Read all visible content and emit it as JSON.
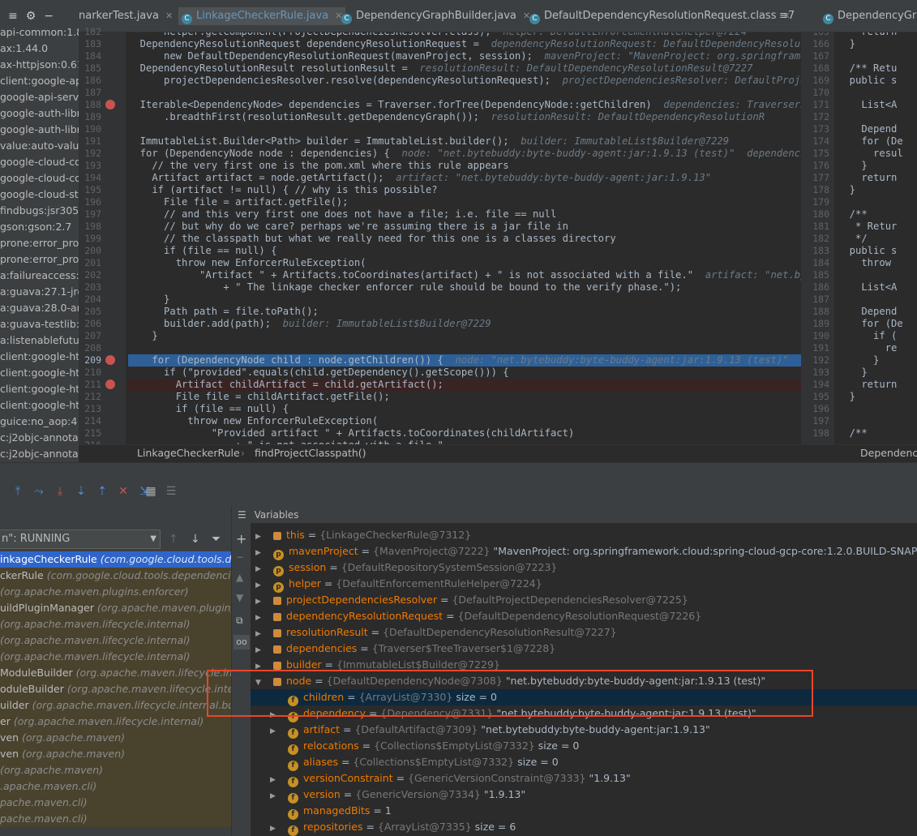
{
  "project_tree": {
    "items": [
      "api-common:1.8.1",
      "ax:1.44.0",
      "ax-httpjson:0.61",
      "client:google-api-c",
      "google-api-servic",
      "google-auth-libra",
      "google-auth-libra",
      "value:auto-value",
      "google-cloud-co",
      "google-cloud-co",
      "google-cloud-st",
      "findbugs:jsr305",
      "gson:gson:2.7",
      "prone:error_pron",
      "prone:error_pron",
      "a:failureaccess:1",
      "a:guava:27.1-jre",
      "a:guava:28.0-an",
      "a:guava-testlib:2",
      "a:listenablefutur",
      "client:google-htt",
      "client:google-htt",
      "client:google-htt",
      "client:google-htt",
      "guice:no_aop:4",
      "c:j2objc-annotat",
      "c:j2objc-annotat"
    ]
  },
  "tabs": [
    {
      "label": "narkerTest.java",
      "active": false,
      "icon": false
    },
    {
      "label": "LinkageCheckerRule.java",
      "active": true,
      "icon": true
    },
    {
      "label": "DependencyGraphBuilder.java",
      "active": false,
      "icon": true
    },
    {
      "label": "DefaultDependencyResolutionRequest.class",
      "active": false,
      "icon": true
    },
    {
      "label": "≡7",
      "active": false,
      "icon": false
    },
    {
      "label": "DependencyGraph",
      "active": false,
      "icon": true
    }
  ],
  "editor": {
    "line_numbers": [
      "182",
      "183",
      "184",
      "185",
      "186",
      "187",
      "188",
      "189",
      "190",
      "191",
      "192",
      "193",
      "194",
      "195",
      "196",
      "197",
      "198",
      "199",
      "200",
      "201",
      "202",
      "203",
      "204",
      "205",
      "206",
      "207",
      "208",
      "209",
      "210",
      "211",
      "212",
      "213",
      "214",
      "215",
      "216"
    ],
    "lines": [
      {
        "code": "      helper.getComponent(ProjectDependenciesResolver.class);",
        "hint": "  helper: DefaultEnforcementRuleHelper@7224"
      },
      {
        "code": "  DependencyResolutionRequest dependencyResolutionRequest =",
        "hint": "  dependencyResolutionRequest: DefaultDependencyResolu"
      },
      {
        "code": "      new DefaultDependencyResolutionRequest(mavenProject, session);",
        "hint": "  mavenProject: \"MavenProject: org.springframe"
      },
      {
        "code": "  DependencyResolutionResult resolutionResult =",
        "hint": "  resolutionResult: DefaultDependencyResolutionResult@7227"
      },
      {
        "code": "      projectDependenciesResolver.resolve(dependencyResolutionRequest);",
        "hint": "  projectDependenciesResolver: DefaultProje"
      },
      {
        "code": "",
        "hint": ""
      },
      {
        "code": "  Iterable<DependencyNode> dependencies = Traverser.forTree(DependencyNode::getChildren)",
        "hint": "  dependencies: Traverser$"
      },
      {
        "code": "      .breadthFirst(resolutionResult.getDependencyGraph());",
        "hint": "  resolutionResult: DefaultDependencyResolutionR"
      },
      {
        "code": "",
        "hint": ""
      },
      {
        "code": "  ImmutableList.Builder<Path> builder = ImmutableList.builder();",
        "hint": "  builder: ImmutableList$Builder@7229"
      },
      {
        "code": "  for (DependencyNode node : dependencies) {",
        "hint": "  node: \"net.bytebuddy:byte-buddy-agent:jar:1.9.13 (test)\"  dependenci"
      },
      {
        "code": "    // the very first one is the pom.xml where this rule appears",
        "hint": ""
      },
      {
        "code": "    Artifact artifact = node.getArtifact();",
        "hint": "  artifact: \"net.bytebuddy:byte-buddy-agent:jar:1.9.13\""
      },
      {
        "code": "    if (artifact != null) { // why is this possible?",
        "hint": ""
      },
      {
        "code": "      File file = artifact.getFile();",
        "hint": ""
      },
      {
        "code": "      // and this very first one does not have a file; i.e. file == null",
        "hint": ""
      },
      {
        "code": "      // but why do we care? perhaps we're assuming there is a jar file in",
        "hint": ""
      },
      {
        "code": "      // the classpath but what we really need for this one is a classes directory",
        "hint": ""
      },
      {
        "code": "      if (file == null) {",
        "hint": ""
      },
      {
        "code": "        throw new EnforcerRuleException(",
        "hint": ""
      },
      {
        "code": "            \"Artifact \" + Artifacts.toCoordinates(artifact) + \" is not associated with a file.\"",
        "hint": "  artifact: \"net.by"
      },
      {
        "code": "                + \" The linkage checker enforcer rule should be bound to the verify phase.\");",
        "hint": ""
      },
      {
        "code": "      }",
        "hint": ""
      },
      {
        "code": "      Path path = file.toPath();",
        "hint": ""
      },
      {
        "code": "      builder.add(path);",
        "hint": "  builder: ImmutableList$Builder@7229"
      },
      {
        "code": "    }",
        "hint": ""
      },
      {
        "code": "",
        "hint": ""
      },
      {
        "code": "    for (DependencyNode child : node.getChildren()) {",
        "hint": "  node: \"net.bytebuddy:byte-buddy-agent:jar:1.9.13 (test)\""
      },
      {
        "code": "      if (\"provided\".equals(child.getDependency().getScope())) {",
        "hint": ""
      },
      {
        "code": "        Artifact childArtifact = child.getArtifact();",
        "hint": ""
      },
      {
        "code": "        File file = childArtifact.getFile();",
        "hint": ""
      },
      {
        "code": "        if (file == null) {",
        "hint": ""
      },
      {
        "code": "          throw new EnforcerRuleException(",
        "hint": ""
      },
      {
        "code": "              \"Provided artifact \" + Artifacts.toCoordinates(childArtifact)",
        "hint": ""
      },
      {
        "code": "                  + \" is not associated with a file.\"",
        "hint": ""
      }
    ],
    "highlight_line_index": 27,
    "error_line_index": 29
  },
  "right_editor": {
    "line_numbers": [
      "165",
      "166",
      "167",
      "168",
      "169",
      "170",
      "171",
      "172",
      "173",
      "174",
      "175",
      "176",
      "177",
      "178",
      "179",
      "180",
      "181",
      "182",
      "183",
      "184",
      "185",
      "186",
      "187",
      "188",
      "189",
      "190",
      "191",
      "192",
      "193",
      "194",
      "195",
      "196",
      "197",
      "198"
    ],
    "lines": [
      "    return",
      "  }",
      "",
      "  /** Retu",
      "  public s",
      "",
      "    List<A",
      "",
      "    Depend",
      "    for (De",
      "      resul",
      "    }",
      "    return",
      "  }",
      "",
      "  /**",
      "   * Retur",
      "   */",
      "  public s",
      "    throw",
      "",
      "    List<A",
      "",
      "    Depend",
      "    for (De",
      "      if (",
      "        re",
      "      }",
      "    }",
      "    return",
      "  }",
      "",
      "",
      "  /**"
    ]
  },
  "breadcrumb": {
    "class": "LinkageCheckerRule",
    "method": "findProjectClasspath()",
    "right": "Dependenc"
  },
  "debug": {
    "thread_label": "n\": RUNNING",
    "variables_title": "Variables",
    "frames": [
      {
        "name": "inkageCheckerRule",
        "pkg": "(com.google.cloud.tools.dep"
      },
      {
        "name": "ckerRule",
        "pkg": "(com.google.cloud.tools.dependencies.e"
      },
      {
        "name": "",
        "pkg": "(org.apache.maven.plugins.enforcer)"
      },
      {
        "name": "uildPluginManager",
        "pkg": "(org.apache.maven.plugin)"
      },
      {
        "name": "",
        "pkg": "(org.apache.maven.lifecycle.internal)"
      },
      {
        "name": "",
        "pkg": "(org.apache.maven.lifecycle.internal)"
      },
      {
        "name": "",
        "pkg": "(org.apache.maven.lifecycle.internal)"
      },
      {
        "name": "ModuleBuilder",
        "pkg": "(org.apache.maven.lifecycle.intern"
      },
      {
        "name": "oduleBuilder",
        "pkg": "(org.apache.maven.lifecycle.interr"
      },
      {
        "name": "uilder",
        "pkg": "(org.apache.maven.lifecycle.internal.build"
      },
      {
        "name": "er",
        "pkg": "(org.apache.maven.lifecycle.internal)"
      },
      {
        "name": "ven",
        "pkg": "(org.apache.maven)"
      },
      {
        "name": "ven",
        "pkg": "(org.apache.maven)"
      },
      {
        "name": "",
        "pkg": "(org.apache.maven)"
      },
      {
        "name": "",
        "pkg": ".apache.maven.cli)"
      },
      {
        "name": "",
        "pkg": "pache.maven.cli)"
      },
      {
        "name": "",
        "pkg": "pache.maven.cli)"
      }
    ],
    "variables": [
      {
        "indent": 0,
        "expand": "▶",
        "icon": "",
        "name": "this",
        "type": "{LinkageCheckerRule@7312}",
        "value": ""
      },
      {
        "indent": 0,
        "expand": "▶",
        "icon": "p",
        "name": "mavenProject",
        "type": "{MavenProject@7222}",
        "value": "\"MavenProject: org.springframework.cloud:spring-cloud-gcp-core:1.2.0.BUILD-SNAPSHOT"
      },
      {
        "indent": 0,
        "expand": "▶",
        "icon": "p",
        "name": "session",
        "type": "{DefaultRepositorySystemSession@7223}",
        "value": ""
      },
      {
        "indent": 0,
        "expand": "▶",
        "icon": "p",
        "name": "helper",
        "type": "{DefaultEnforcementRuleHelper@7224}",
        "value": ""
      },
      {
        "indent": 0,
        "expand": "▶",
        "icon": "",
        "name": "projectDependenciesResolver",
        "type": "{DefaultProjectDependenciesResolver@7225}",
        "value": ""
      },
      {
        "indent": 0,
        "expand": "▶",
        "icon": "",
        "name": "dependencyResolutionRequest",
        "type": "{DefaultDependencyResolutionRequest@7226}",
        "value": ""
      },
      {
        "indent": 0,
        "expand": "▶",
        "icon": "",
        "name": "resolutionResult",
        "type": "{DefaultDependencyResolutionResult@7227}",
        "value": ""
      },
      {
        "indent": 0,
        "expand": "▶",
        "icon": "",
        "name": "dependencies",
        "type": "{Traverser$TreeTraverser$1@7228}",
        "value": ""
      },
      {
        "indent": 0,
        "expand": "▶",
        "icon": "",
        "name": "builder",
        "type": "{ImmutableList$Builder@7229}",
        "value": ""
      },
      {
        "indent": 0,
        "expand": "▼",
        "icon": "",
        "name": "node",
        "type": "{DefaultDependencyNode@7308}",
        "value": "\"net.bytebuddy:byte-buddy-agent:jar:1.9.13 (test)\""
      },
      {
        "indent": 1,
        "expand": "",
        "icon": "f",
        "name": "children",
        "type": "{ArrayList@7330}",
        "value": " size = 0"
      },
      {
        "indent": 1,
        "expand": "▶",
        "icon": "f",
        "name": "dependency",
        "type": "{Dependency@7331}",
        "value": "\"net.bytebuddy:byte-buddy-agent:jar:1.9.13 (test)\""
      },
      {
        "indent": 1,
        "expand": "▶",
        "icon": "f",
        "name": "artifact",
        "type": "{DefaultArtifact@7309}",
        "value": "\"net.bytebuddy:byte-buddy-agent:jar:1.9.13\""
      },
      {
        "indent": 1,
        "expand": "",
        "icon": "f",
        "name": "relocations",
        "type": "{Collections$EmptyList@7332}",
        "value": " size = 0"
      },
      {
        "indent": 1,
        "expand": "",
        "icon": "f",
        "name": "aliases",
        "type": "{Collections$EmptyList@7332}",
        "value": " size = 0"
      },
      {
        "indent": 1,
        "expand": "▶",
        "icon": "f",
        "name": "versionConstraint",
        "type": "{GenericVersionConstraint@7333}",
        "value": "\"1.9.13\""
      },
      {
        "indent": 1,
        "expand": "▶",
        "icon": "f",
        "name": "version",
        "type": "{GenericVersion@7334}",
        "value": "\"1.9.13\""
      },
      {
        "indent": 1,
        "expand": "",
        "icon": "f",
        "name": "managedBits",
        "type": "",
        "value": "1"
      },
      {
        "indent": 1,
        "expand": "▶",
        "icon": "f",
        "name": "repositories",
        "type": "{ArrayList@7335}",
        "value": " size = 6"
      }
    ],
    "selected_variable_index": 10
  },
  "colors": {
    "highlight_line": "#2d6099",
    "annotation_box": "#e8462a",
    "selected_frame": "#2f65ca"
  }
}
